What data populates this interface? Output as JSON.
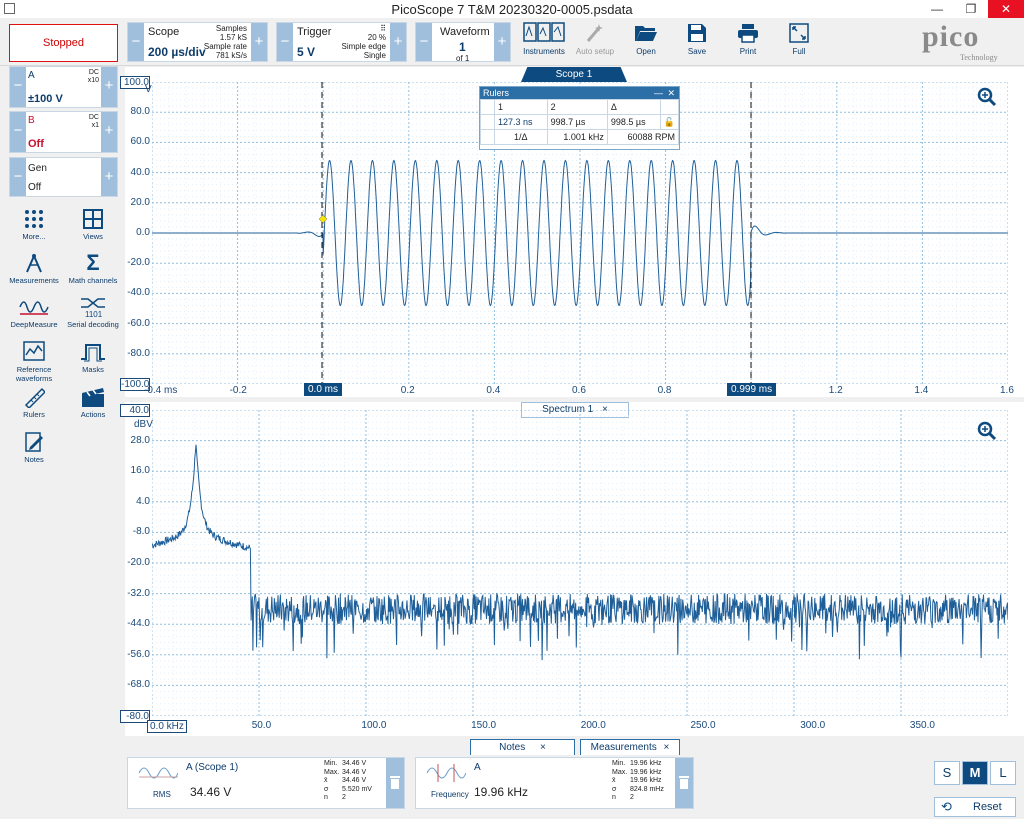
{
  "window": {
    "title": "PicoScope 7 T&M 20230320-0005.psdata",
    "minimize": "—",
    "restore": "❐",
    "close": "✕"
  },
  "toolbar": {
    "scope": {
      "label": "Scope",
      "timebase": "200 µs/div",
      "samples_label": "Samples",
      "samples": "1.57 kS",
      "rate_label": "Sample rate",
      "rate": "781 kS/s"
    },
    "trigger": {
      "label": "Trigger",
      "level": "5 V",
      "percent": "20 %",
      "type": "Simple edge",
      "mode": "Single"
    },
    "waveform": {
      "label": "Waveform",
      "index": "1",
      "of": "of 1"
    },
    "tools": [
      {
        "label": "Instruments",
        "icon": "instruments-icon",
        "enabled": true
      },
      {
        "label": "Auto setup",
        "icon": "auto-setup-icon",
        "enabled": false
      },
      {
        "label": "Open",
        "icon": "open-folder-icon",
        "enabled": true
      },
      {
        "label": "Save",
        "icon": "save-icon",
        "enabled": true
      },
      {
        "label": "Print",
        "icon": "print-icon",
        "enabled": true
      },
      {
        "label": "Full",
        "icon": "fullscreen-icon",
        "enabled": true
      }
    ],
    "logo": {
      "text": "pico",
      "sub": "Technology"
    }
  },
  "left": {
    "status": "Stopped",
    "channels": [
      {
        "name": "A",
        "value": "±100 V",
        "coupling": "DC",
        "probe": "x10",
        "color": "#0d3c6b"
      },
      {
        "name": "B",
        "value": "Off",
        "coupling": "DC",
        "probe": "x1",
        "color": "#c8102e"
      },
      {
        "name": "Gen",
        "value": "Off",
        "coupling": "",
        "probe": "",
        "color": "#222222"
      }
    ],
    "buttons": [
      {
        "label": "More...",
        "icon": "more-dots-icon"
      },
      {
        "label": "Views",
        "icon": "views-grid-icon"
      },
      {
        "label": "Measurements",
        "icon": "measurements-icon"
      },
      {
        "label": "Math channels",
        "icon": "sigma-icon"
      },
      {
        "label": "DeepMeasure",
        "icon": "deepmeasure-icon"
      },
      {
        "label": "Serial decoding",
        "icon": "serial-decoding-icon"
      },
      {
        "label": "Reference waveforms",
        "icon": "reference-waveforms-icon"
      },
      {
        "label": "Masks",
        "icon": "masks-icon"
      },
      {
        "label": "Rulers",
        "icon": "rulers-icon"
      },
      {
        "label": "Actions",
        "icon": "actions-icon"
      },
      {
        "label": "Notes",
        "icon": "notes-icon"
      }
    ]
  },
  "scope_view": {
    "tab": "Scope 1",
    "unit": "V",
    "y_ticks": [
      "100.0",
      "80.0",
      "60.0",
      "40.0",
      "20.0",
      "0.0",
      "-20.0",
      "-40.0",
      "-60.0",
      "-80.0",
      "-100.0"
    ],
    "x_ticks": [
      "-0.4 ms",
      "-0.2",
      "0.0 ms",
      "0.2",
      "0.4",
      "0.6",
      "0.8",
      "0.999 ms",
      "1.2",
      "1.4",
      "1.6"
    ],
    "ruler1": "0.0 ms",
    "ruler2": "0.999 ms"
  },
  "rulers_panel": {
    "title": "Rulers",
    "h1": "1",
    "h2": "2",
    "h3": "Δ",
    "v1": "127.3 ns",
    "v2": "998.7 µs",
    "v3": "998.5 µs",
    "inv_label": "1/Δ",
    "freq": "1.001 kHz",
    "rpm": "60088 RPM"
  },
  "spectrum_view": {
    "tab": "Spectrum 1",
    "unit": "dBV",
    "y_ticks": [
      "40.0",
      "28.0",
      "16.0",
      "4.0",
      "-8.0",
      "-20.0",
      "-32.0",
      "-44.0",
      "-56.0",
      "-68.0",
      "-80.0"
    ],
    "x_ticks": [
      "0.0 kHz",
      "50.0",
      "100.0",
      "150.0",
      "200.0",
      "250.0",
      "300.0",
      "350.0"
    ]
  },
  "bottom": {
    "tabs": [
      "Notes",
      "Measurements"
    ],
    "measurements": [
      {
        "channel": "A (Scope 1)",
        "type": "RMS",
        "value": "34.46 V",
        "stats": [
          [
            "Min.",
            "34.46 V"
          ],
          [
            "Max.",
            "34.46 V"
          ],
          [
            "x̄",
            "34.46 V"
          ],
          [
            "σ",
            "5.520 mV"
          ],
          [
            "n",
            "2"
          ]
        ]
      },
      {
        "channel": "A",
        "type": "Frequency",
        "value": "19.96 kHz",
        "stats": [
          [
            "Min.",
            "19.96 kHz"
          ],
          [
            "Max.",
            "19.96 kHz"
          ],
          [
            "x̄",
            "19.96 kHz"
          ],
          [
            "σ",
            "824.8 mHz"
          ],
          [
            "n",
            "2"
          ]
        ]
      }
    ],
    "sizes": [
      "S",
      "M",
      "L"
    ],
    "reset": "Reset"
  },
  "colors": {
    "trace": "#1f5f99",
    "accent": "#0d4a7f",
    "stopped": "#cc0000",
    "grid": "#9cc7e6"
  }
}
